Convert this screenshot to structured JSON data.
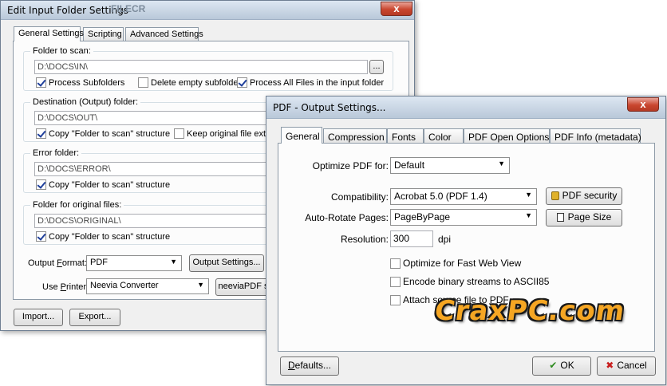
{
  "input_window": {
    "title": "Edit Input Folder Settings",
    "watermark": "FILECR",
    "close_label": "x",
    "tabs": [
      "General Settings",
      "Scripting",
      "Advanced Settings"
    ],
    "scan": {
      "label": "Folder to scan:",
      "path": "D:\\DOCS\\IN\\",
      "browse_label": "...",
      "process_subfolders": "Process Subfolders",
      "delete_empty": "Delete empty subfolders",
      "process_all": "Process All Files in the input folder"
    },
    "destination": {
      "label": "Destination (Output) folder:",
      "path": "D:\\DOCS\\OUT\\",
      "copy_structure": "Copy \"Folder to scan\" structure",
      "keep_ext": "Keep original file extensi"
    },
    "error": {
      "label": "Error folder:",
      "path": "D:\\DOCS\\ERROR\\",
      "copy_structure": "Copy \"Folder to scan\" structure"
    },
    "original": {
      "label": "Folder for original files:",
      "path": "D:\\DOCS\\ORIGINAL\\",
      "copy_structure": "Copy \"Folder to scan\" structure"
    },
    "output_format_label_pre": "Output ",
    "output_format_label_u": "F",
    "output_format_label_post": "ormat:",
    "output_format_value": "PDF",
    "output_settings_button": "Output Settings...",
    "use_printer_label_pre": "Use ",
    "use_printer_label_u": "P",
    "use_printer_label_post": "rinter:",
    "printer_value": "Neevia Converter",
    "neevia_button": "neeviaPDF s",
    "import_button": "Import...",
    "export_button": "Export..."
  },
  "pdf_window": {
    "title": "PDF - Output Settings...",
    "close_label": "x",
    "tabs": [
      "General",
      "Compression",
      "Fonts",
      "Color",
      "PDF Open Options",
      "PDF Info (metadata)"
    ],
    "optimize_label": "Optimize PDF for:",
    "optimize_value": "Default",
    "compat_label": "Compatibility:",
    "compat_value": "Acrobat 5.0 (PDF 1.4)",
    "rotate_label": "Auto-Rotate Pages:",
    "rotate_value": "PageByPage",
    "resolution_label": "Resolution:",
    "resolution_value": "300",
    "resolution_unit": "dpi",
    "pdf_security_button": "PDF security",
    "page_size_button": "Page Size",
    "fast_web": "Optimize for Fast Web View",
    "ascii85": "Encode binary streams to ASCII85",
    "attach_source": "Attach source file to PDF",
    "defaults_pre": "",
    "defaults_u": "D",
    "defaults_post": "efaults...",
    "ok_button": "OK",
    "cancel_button": "Cancel"
  },
  "watermark_text": "CraxPC.com",
  "colors": {
    "accent_orange": "#f5a623",
    "ok_green": "#2e8b20",
    "cancel_red": "#c81e1e"
  }
}
